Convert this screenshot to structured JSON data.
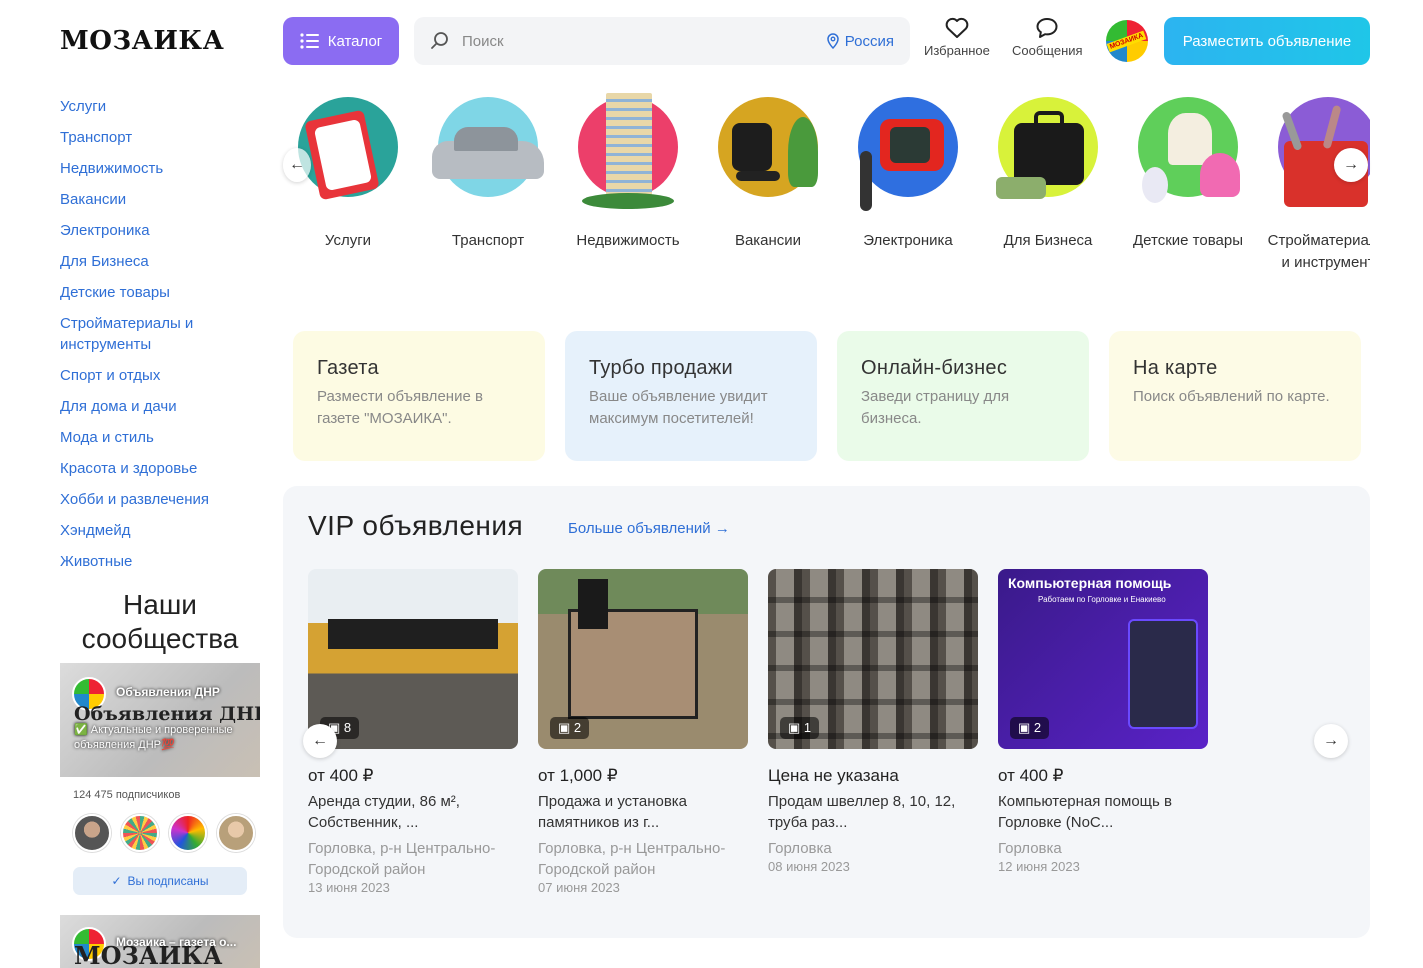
{
  "header": {
    "logo": "МОЗАИКА",
    "catalog_label": "Каталог",
    "search_placeholder": "Поиск",
    "region": "Россия",
    "favorites_label": "Избранное",
    "messages_label": "Сообщения",
    "avatar_text": "МОЗАИКА",
    "post_button": "Разместить объявление",
    "accent_color": "#8b6cf2",
    "link_color": "#2f6fd6"
  },
  "sidebar": {
    "items": [
      "Услуги",
      "Транспорт",
      "Недвижимость",
      "Вакансии",
      "Электроника",
      "Для Бизнеса",
      "Детские товары",
      "Стройматериалы и инструменты",
      "Спорт и отдых",
      "Для дома и дачи",
      "Мода и стиль",
      "Красота и здоровье",
      "Хобби и развлечения",
      "Хэндмейд",
      "Животные"
    ]
  },
  "communities": {
    "title": "Наши сообщества",
    "card1": {
      "name": "Объявления ДНР",
      "big_text": "Объявления ДНР",
      "description": "✅ Актуальные и проверенные объявления ДНР💯"
    },
    "subscribers": "124 475 подписчиков",
    "subscribed_label": "Вы подписаны",
    "card2": {
      "name": "Мозаика – газета о...",
      "big_text": "МОЗАИКА"
    }
  },
  "categories": [
    {
      "label": "Услуги",
      "icon": "clipboard-icon",
      "color": "#2aa39a"
    },
    {
      "label": "Транспорт",
      "icon": "car-icon",
      "color": "#7fd6e6"
    },
    {
      "label": "Недвижимость",
      "icon": "building-icon",
      "color": "#ec3f6a"
    },
    {
      "label": "Вакансии",
      "icon": "office-chair-icon",
      "color": "#d6a521"
    },
    {
      "label": "Электроника",
      "icon": "tv-icon",
      "color": "#2f6fe0"
    },
    {
      "label": "Для Бизнеса",
      "icon": "briefcase-icon",
      "color": "#d8f23a"
    },
    {
      "label": "Детские товары",
      "icon": "toys-icon",
      "color": "#5fcf5a"
    },
    {
      "label": "Стройматериалы и инструмент",
      "icon": "toolbox-icon",
      "color": "#8b5cd6"
    }
  ],
  "promos": [
    {
      "title": "Газета",
      "text": "Размести объявление в газете \"МОЗАИКА\".",
      "bg": "#fdfbe3"
    },
    {
      "title": "Турбо продажи",
      "text": "Ваше объявление увидит максимум посетителей!",
      "bg": "#e6f1fb"
    },
    {
      "title": "Онлайн-бизнес",
      "text": "Заведи страницу для бизнеса.",
      "bg": "#eafbe9"
    },
    {
      "title": "На карте",
      "text": "Поиск объявлений по карте.",
      "bg": "#fdfbe6"
    }
  ],
  "vip": {
    "title": "VIP объявления",
    "more_label": "Больше объявлений",
    "ads": [
      {
        "photos": "8",
        "price": "от 400 ₽",
        "title": "Аренда студии, 86 м², Собственник, ...",
        "location": "Горловка, р-н Центрально-Городской район",
        "date": "13 июня 2023"
      },
      {
        "photos": "2",
        "price": "от 1,000 ₽",
        "title": "Продажа и установка памятников из г...",
        "location": "Горловка, р-н Центрально-Городской район",
        "date": "07 июня 2023"
      },
      {
        "photos": "1",
        "price": "Цена не указана",
        "title": "Продам швеллер 8, 10, 12, труба раз...",
        "location": "Горловка",
        "date": "08 июня 2023"
      },
      {
        "photos": "2",
        "price": "от 400 ₽",
        "title": "Компьютерная помощь в Горловке (NoC...",
        "location": "Горловка",
        "date": "12 июня 2023"
      }
    ],
    "ad4_banner_title": "Компьютерная помощь",
    "ad4_banner_sub": "Работаем по Горловке и Енакиево"
  }
}
